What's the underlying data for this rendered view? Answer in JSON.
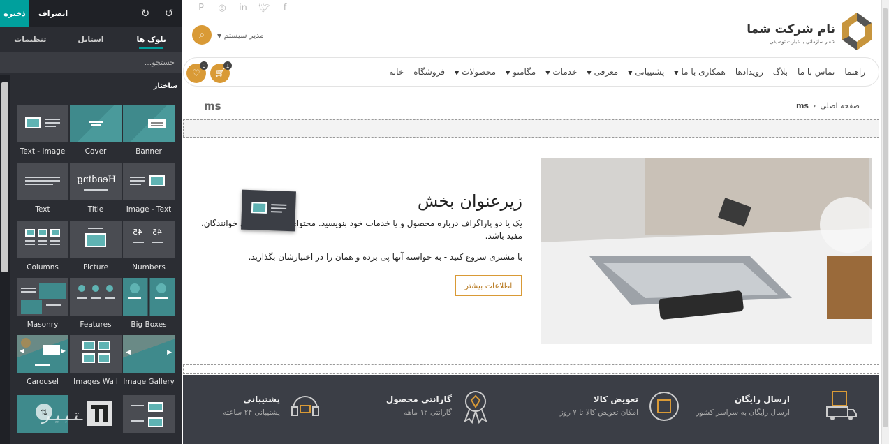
{
  "editor": {
    "save": "ذخیره",
    "discard": "انصراف",
    "tabs": [
      "بلوک ها",
      "استایل",
      "تنظیمات"
    ],
    "search_placeholder": "جستجو...",
    "section_title": "ساختار",
    "blocks": [
      "Banner",
      "Cover",
      "Text - Image",
      "Image - Text",
      "Title",
      "Text",
      "Numbers",
      "Picture",
      "Columns",
      "Big Boxes",
      "Features",
      "Masonry",
      "Image Gallery",
      "Images Wall",
      "Carousel"
    ],
    "numbers_glyph": "45",
    "heading_glyph": "Heading"
  },
  "site": {
    "logo_title": "نام شرکت شما",
    "logo_subtitle": "شعار سازمانی یا عبارت توصیفی",
    "social": [
      "facebook-icon",
      "twitter-icon",
      "linkedin-icon",
      "instagram-icon",
      "pinterest-icon"
    ],
    "user_name": "مدیر سیستم",
    "nav": [
      {
        "label": "خانه",
        "caret": false
      },
      {
        "label": "فروشگاه",
        "caret": false
      },
      {
        "label": "محصولات",
        "caret": true
      },
      {
        "label": "مگامنو",
        "caret": true
      },
      {
        "label": "خدمات",
        "caret": true
      },
      {
        "label": "معرفی",
        "caret": true
      },
      {
        "label": "پشتیبانی",
        "caret": true
      },
      {
        "label": "همکاری با ما",
        "caret": true
      },
      {
        "label": "رویدادها",
        "caret": false
      },
      {
        "label": "بلاگ",
        "caret": false
      },
      {
        "label": "تماس با ما",
        "caret": false
      },
      {
        "label": "راهنما",
        "caret": false
      }
    ],
    "cart_count": "1",
    "wishlist_count": "0",
    "breadcrumb_home": "صفحه اصلی",
    "breadcrumb_current": "ms",
    "page_name": "ms",
    "hero": {
      "title": "زیرعنوان بخش",
      "p1": "یک یا دو پاراگراف درباره محصول و یا خدمات خود بنویسید. محتوای شما باید برای خوانندگان، مفید باشد.",
      "p2": "با مشتری شروع کنید - به خواسته آنها پی برده و همان را در اختیارشان بگذارید.",
      "button": "اطلاعات بیشتر"
    },
    "features": [
      {
        "title": "ارسال رایگان",
        "sub": "ارسال رایگان به سراسر کشور"
      },
      {
        "title": "تعویض کالا",
        "sub": "امکان تعویض کالا تا ۷ روز"
      },
      {
        "title": "گارانتی محصول",
        "sub": "گارانتی ۱۲ ماهه"
      },
      {
        "title": "پشتیبانی",
        "sub": "پشتیبانی ۲۴ ساعته"
      }
    ],
    "accent": "#d99a36",
    "editor_accent": "#00a09d"
  }
}
